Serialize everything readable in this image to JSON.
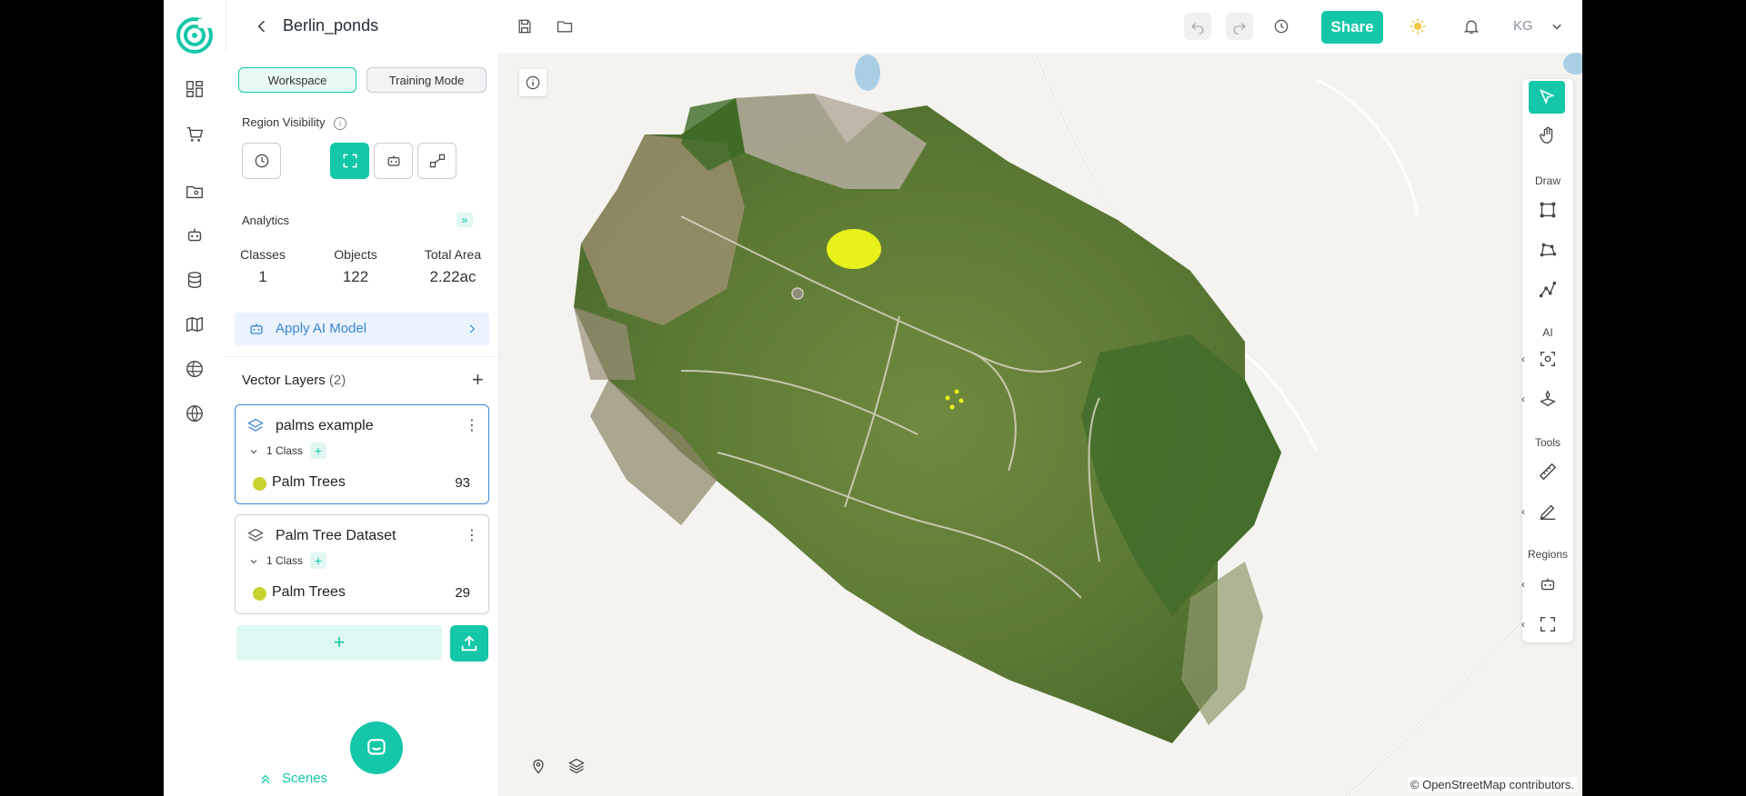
{
  "project": {
    "title": "Berlin_ponds"
  },
  "topbar": {
    "share_label": "Share",
    "user_initials": "KG"
  },
  "panel": {
    "workspace_label": "Workspace",
    "training_mode_label": "Training Mode",
    "region_visibility_label": "Region Visibility",
    "analytics_label": "Analytics",
    "stats": [
      {
        "label": "Classes",
        "value": "1"
      },
      {
        "label": "Objects",
        "value": "122"
      },
      {
        "label": "Total Area",
        "value": "2.22ac"
      }
    ],
    "apply_ai_label": "Apply AI Model",
    "vector_layers_label": "Vector Layers",
    "vector_layers_count": "(2)",
    "layers": [
      {
        "name": "palms example",
        "class_tag": "1 Class",
        "class_name": "Palm Trees",
        "count": "93"
      },
      {
        "name": "Palm Tree Dataset",
        "class_tag": "1 Class",
        "class_name": "Palm Trees",
        "count": "29"
      }
    ],
    "add_symbol": "+",
    "scenes_label": "Scenes"
  },
  "toolbar": {
    "draw_label": "Draw",
    "ai_label": "AI",
    "tools_label": "Tools",
    "regions_label": "Regions"
  },
  "map": {
    "attribution": "© OpenStreetMap contributors."
  },
  "colors": {
    "accent": "#14c7a8",
    "class_color": "#c9d32f",
    "ai_blue": "#3a86d6"
  }
}
